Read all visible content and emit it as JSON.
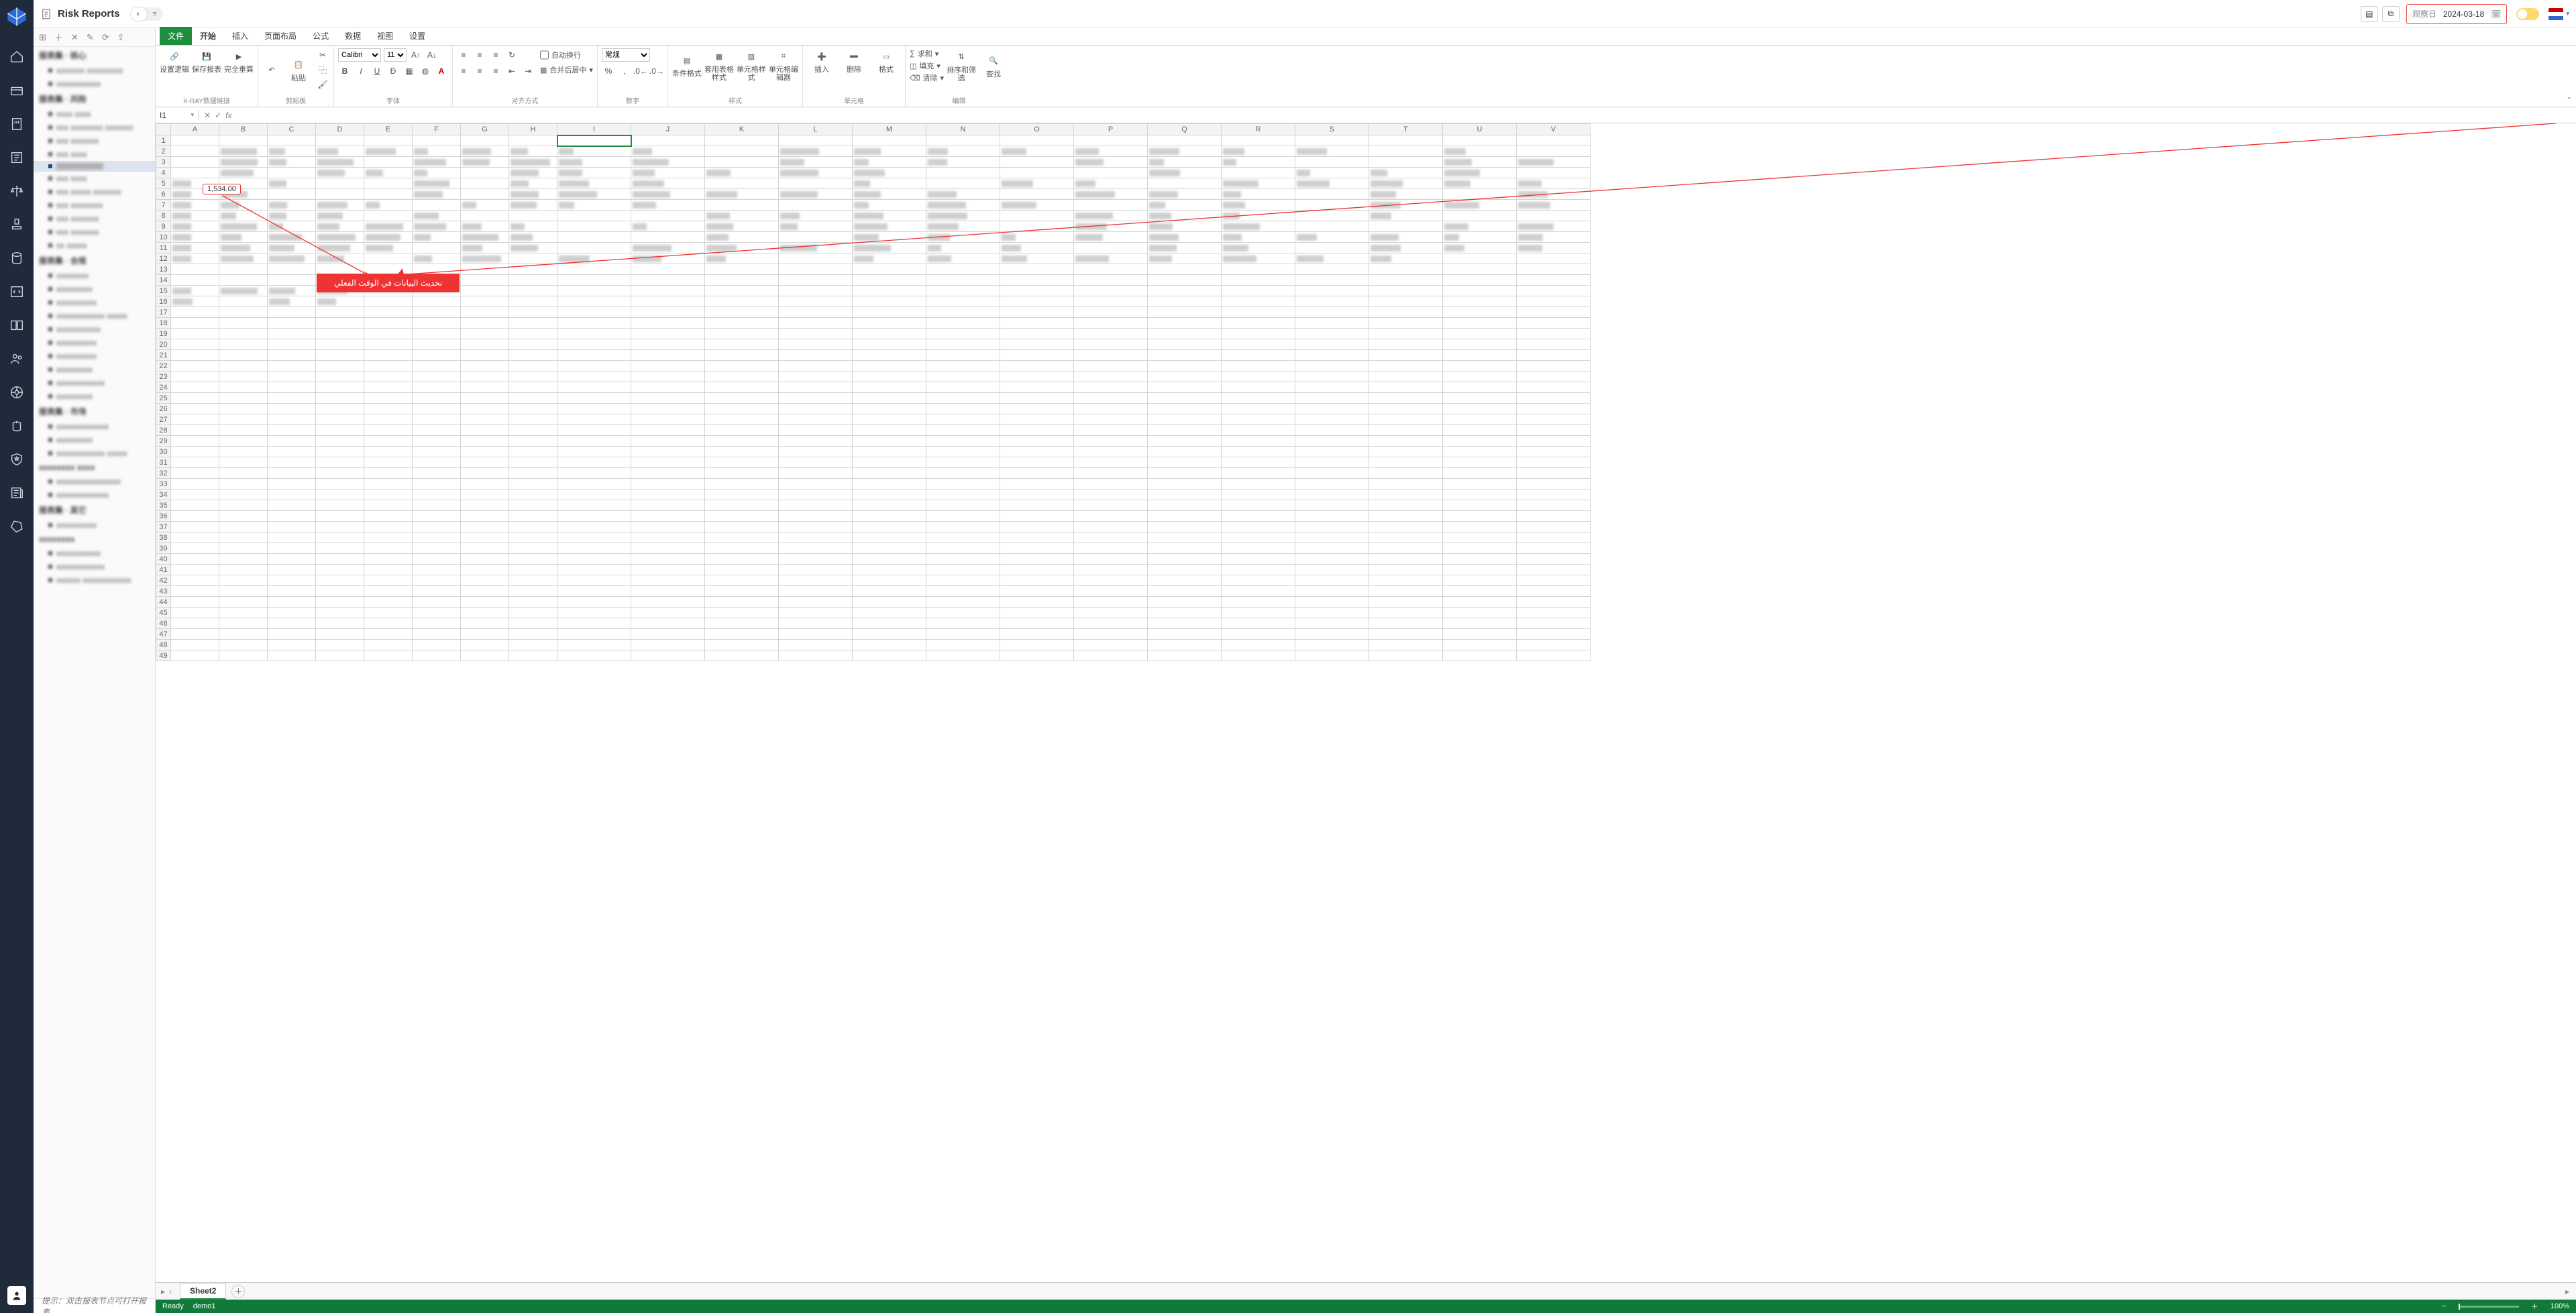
{
  "header": {
    "title": "Risk Reports",
    "date_label": "观察日",
    "date_value": "2024-03-18"
  },
  "ribbon": {
    "tabs": {
      "file": "文件",
      "home": "开始",
      "insert": "插入",
      "layout": "页面布局",
      "formula": "公式",
      "data": "数据",
      "view": "视图",
      "settings": "设置"
    },
    "groups": {
      "xray": "X-RAY数据链接",
      "clipboard": "剪贴板",
      "font": "字体",
      "align": "对齐方式",
      "number": "数字",
      "style": "样式",
      "cells": "单元格",
      "edit": "编辑"
    },
    "btns": {
      "setlogic": "设置逻辑",
      "savereport": "保存报表",
      "fullrecalc": "完全重算",
      "paste": "粘贴",
      "wrap": "自动换行",
      "merge": "合并后居中",
      "numfmt": "常规",
      "condfmt": "条件格式",
      "tablestyle": "套用表格样式",
      "cellstyle": "单元格样式",
      "celledit": "单元格编辑器",
      "ins": "插入",
      "del": "删除",
      "fmt": "格式",
      "sum": "求和",
      "fill": "填充",
      "clear": "清除",
      "sort": "排序和筛选",
      "find": "查找"
    },
    "font_name": "Calibri",
    "font_size": "11"
  },
  "formula_bar": {
    "name_box": "I1"
  },
  "columns": [
    "A",
    "B",
    "C",
    "D",
    "E",
    "F",
    "G",
    "H",
    "I",
    "J",
    "K",
    "L",
    "M",
    "N",
    "O",
    "P",
    "Q",
    "R",
    "S",
    "T",
    "U",
    "V"
  ],
  "highlight_value": "1,534.00",
  "callout": "تحديث البيانات في الوقت الفعلي",
  "sheet_tabs": {
    "active": "Sheet2"
  },
  "statusbar": {
    "ready": "Ready",
    "user": "demo1",
    "zoom": "100%"
  },
  "hint": "提示：双击报表节点可打开报表",
  "tree": {
    "groups": [
      "报表集 · 核心",
      "报表集 · 风险",
      "报表集 · 合规",
      "报表集 · 市场",
      "报表集 · 其它"
    ]
  }
}
